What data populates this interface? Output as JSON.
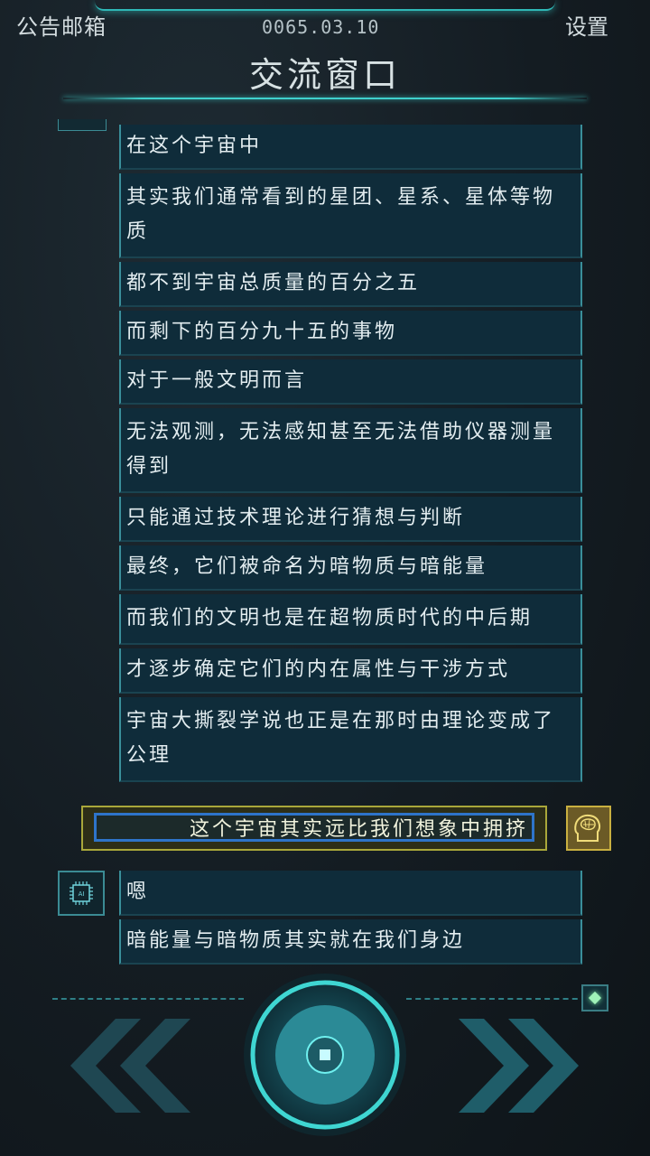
{
  "header": {
    "mailbox_label": "公告邮箱",
    "date": "0065.03.10",
    "settings_label": "设置",
    "title": "交流窗口"
  },
  "ai_messages_before": [
    "在这个宇宙中",
    "其实我们通常看到的星团、星系、星体等物质",
    "都不到宇宙总质量的百分之五",
    "而剩下的百分九十五的事物",
    "对于一般文明而言",
    "无法观测，无法感知甚至无法借助仪器测量得到",
    "只能通过技术理论进行猜想与判断",
    "最终，它们被命名为暗物质与暗能量",
    "而我们的文明也是在超物质时代的中后期",
    "才逐步确定它们的内在属性与干涉方式",
    "宇宙大撕裂学说也正是在那时由理论变成了公理"
  ],
  "player_message": "这个宇宙其实远比我们想象中拥挤",
  "ai_avatar_label": "AI",
  "ai_messages_after": [
    "嗯",
    "暗能量与暗物质其实就在我们身边"
  ],
  "colors": {
    "accent": "#3fd0cc",
    "bubble_bg": "#0f2c3a",
    "player_border": "#a9a73a",
    "player_focus": "#2e74c9"
  },
  "icons": {
    "player": "brain-head-icon",
    "ai": "chip-icon",
    "center": "record-icon",
    "left": "double-chevron-left-icon",
    "right": "double-chevron-right-icon",
    "corner": "diamond-icon"
  }
}
